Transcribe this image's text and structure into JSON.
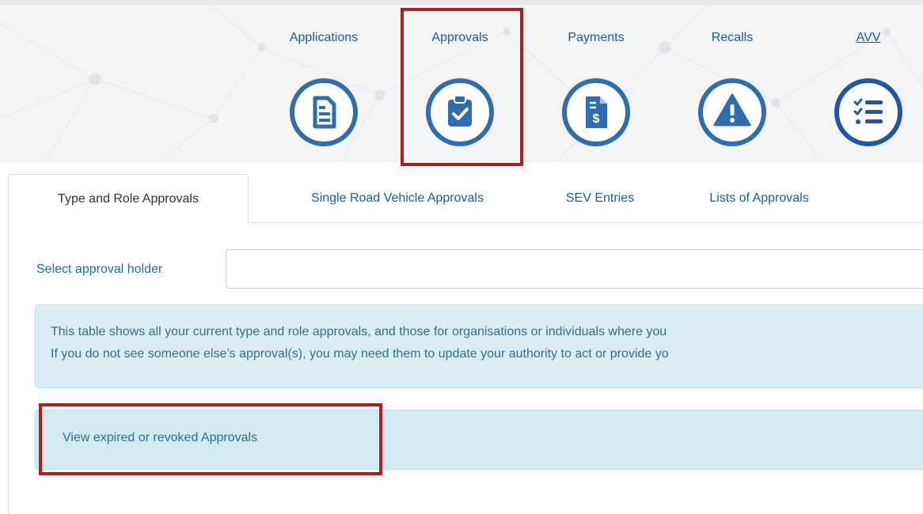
{
  "nav": {
    "items": [
      {
        "label": "Applications",
        "icon": "document-icon"
      },
      {
        "label": "Approvals",
        "icon": "clipboard-check-icon"
      },
      {
        "label": "Payments",
        "icon": "dollar-document-icon"
      },
      {
        "label": "Recalls",
        "icon": "warning-triangle-icon"
      },
      {
        "label": "AVV",
        "icon": "checklist-icon"
      }
    ]
  },
  "tabs": [
    {
      "label": "Type and Role Approvals",
      "active": true
    },
    {
      "label": "Single Road Vehicle Approvals",
      "active": false
    },
    {
      "label": "SEV Entries",
      "active": false
    },
    {
      "label": "Lists of Approvals",
      "active": false
    }
  ],
  "select_holder": {
    "label": "Select approval holder",
    "value": ""
  },
  "info": {
    "line1": "This table shows all your current type and role approvals, and those for organisations or individuals where you",
    "line2": "If you do not see someone else’s approval(s), you may need them to update your authority to act or provide yo"
  },
  "expired": {
    "link_label": "View expired or revoked Approvals"
  },
  "colors": {
    "accent": "#2f6db1",
    "highlight": "#b01d1d",
    "info_bg": "#d9edf3"
  }
}
